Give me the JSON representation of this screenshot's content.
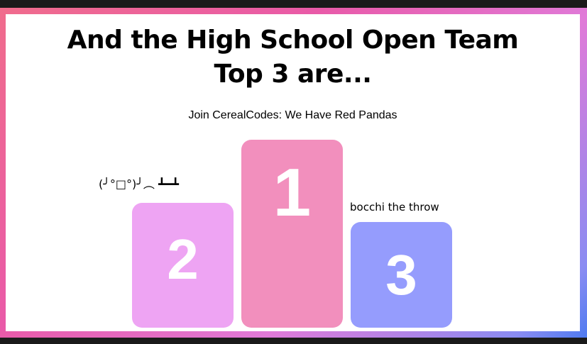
{
  "slide": {
    "title_line1": "And the High School Open Team",
    "title_line2": "Top 3 are...",
    "subtitle": "Join CerealCodes: We Have Red Pandas"
  },
  "podium": {
    "first": {
      "rank": "1",
      "team": ""
    },
    "second": {
      "rank": "2",
      "team": "(╯°□°)╯︵ ┻━┻"
    },
    "third": {
      "rank": "3",
      "team": "bocchi the throw"
    }
  },
  "colors": {
    "podium_first": "#f28fbd",
    "podium_second": "#eea4f3",
    "podium_third": "#959cfd",
    "frame_gradient_start": "#f06c8c",
    "frame_gradient_end": "#4f7bf0"
  }
}
